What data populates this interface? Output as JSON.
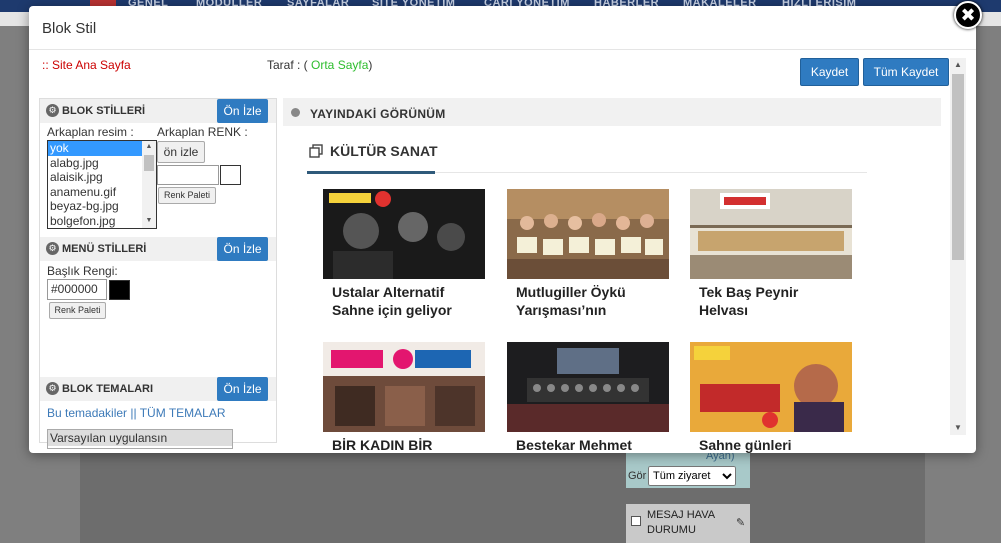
{
  "background": {
    "nav_items": [
      "GENEL",
      "MODÜLLER",
      "SAYFALAR",
      "SİTE YÖNETİM",
      "CARİ YÖNETİM",
      "HABERLER",
      "MAKALELER",
      "HIZLI ERİŞİM"
    ],
    "widget_ayan": "Ayan)",
    "widget_gor": "Gör",
    "widget_select": "Tüm ziyaret",
    "widget2_text": "MESAJ HAVA DURUMU"
  },
  "modal": {
    "title": "Blok Stil",
    "close_glyph": "✖",
    "breadcrumb": ":: Site Ana Sayfa",
    "taraf_label": "Taraf : ( ",
    "taraf_value": "Orta Sayfa",
    "taraf_close": ")",
    "save_label": "Kaydet",
    "save_all_label": "Tüm Kaydet"
  },
  "left_panel": {
    "blok_stilleri": {
      "title": "BLOK STİLLERİ",
      "preview_label": "Ön İzle",
      "bg_image_label": "Arkaplan resim :",
      "bg_color_label": "Arkaplan RENK :",
      "images": [
        "yok",
        "alabg.jpg",
        "alaisik.jpg",
        "anamenu.gif",
        "beyaz-bg.jpg",
        "bolgefon.jpg"
      ],
      "onizle_label": "ön izle",
      "palette_label": "Renk Paleti"
    },
    "menu_stilleri": {
      "title": "MENÜ STİLLERİ",
      "preview_label": "Ön İzle",
      "header_color_label": "Başlık Rengi:",
      "header_color_value": "#000000",
      "palette_label": "Renk Paleti"
    },
    "blok_temalari": {
      "title": "BLOK TEMALARI",
      "preview_label": "Ön İzle",
      "links": "Bu temadakiler || TÜM TEMALAR",
      "selected_theme": "Varsayılan uygulansın"
    }
  },
  "preview": {
    "header": "YAYINDAKİ GÖRÜNÜM",
    "section_title": "KÜLTÜR SANAT",
    "cards": [
      {
        "caption": "Ustalar Alternatif Sahne için geliyor"
      },
      {
        "caption": "Mutlugiller Öykü Yarışması’nın"
      },
      {
        "caption": "Tek Baş Peynir Helvası"
      },
      {
        "caption": "BİR KADIN BİR"
      },
      {
        "caption": "Bestekar Mehmet"
      },
      {
        "caption": "Sahne günleri"
      }
    ]
  },
  "colors": {
    "accent": "#2f7bc1",
    "breadcrumb": "#cc0000",
    "green": "#2ebd2e",
    "link": "#3d7ab8"
  }
}
